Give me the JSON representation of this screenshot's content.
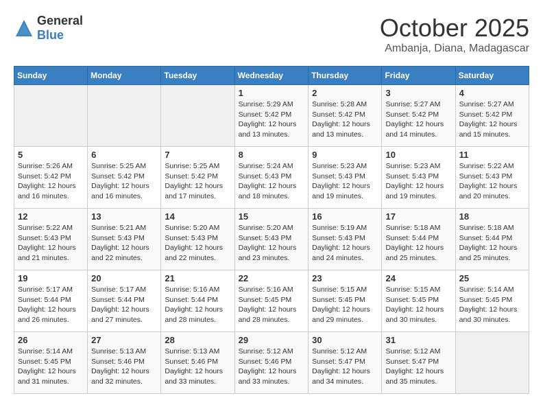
{
  "header": {
    "logo": {
      "general": "General",
      "blue": "Blue"
    },
    "title": "October 2025",
    "location": "Ambanja, Diana, Madagascar"
  },
  "calendar": {
    "days_of_week": [
      "Sunday",
      "Monday",
      "Tuesday",
      "Wednesday",
      "Thursday",
      "Friday",
      "Saturday"
    ],
    "weeks": [
      [
        {
          "day": "",
          "info": ""
        },
        {
          "day": "",
          "info": ""
        },
        {
          "day": "",
          "info": ""
        },
        {
          "day": "1",
          "sunrise": "Sunrise: 5:29 AM",
          "sunset": "Sunset: 5:42 PM",
          "daylight": "Daylight: 12 hours and 13 minutes."
        },
        {
          "day": "2",
          "sunrise": "Sunrise: 5:28 AM",
          "sunset": "Sunset: 5:42 PM",
          "daylight": "Daylight: 12 hours and 13 minutes."
        },
        {
          "day": "3",
          "sunrise": "Sunrise: 5:27 AM",
          "sunset": "Sunset: 5:42 PM",
          "daylight": "Daylight: 12 hours and 14 minutes."
        },
        {
          "day": "4",
          "sunrise": "Sunrise: 5:27 AM",
          "sunset": "Sunset: 5:42 PM",
          "daylight": "Daylight: 12 hours and 15 minutes."
        }
      ],
      [
        {
          "day": "5",
          "sunrise": "Sunrise: 5:26 AM",
          "sunset": "Sunset: 5:42 PM",
          "daylight": "Daylight: 12 hours and 16 minutes."
        },
        {
          "day": "6",
          "sunrise": "Sunrise: 5:25 AM",
          "sunset": "Sunset: 5:42 PM",
          "daylight": "Daylight: 12 hours and 16 minutes."
        },
        {
          "day": "7",
          "sunrise": "Sunrise: 5:25 AM",
          "sunset": "Sunset: 5:42 PM",
          "daylight": "Daylight: 12 hours and 17 minutes."
        },
        {
          "day": "8",
          "sunrise": "Sunrise: 5:24 AM",
          "sunset": "Sunset: 5:43 PM",
          "daylight": "Daylight: 12 hours and 18 minutes."
        },
        {
          "day": "9",
          "sunrise": "Sunrise: 5:23 AM",
          "sunset": "Sunset: 5:43 PM",
          "daylight": "Daylight: 12 hours and 19 minutes."
        },
        {
          "day": "10",
          "sunrise": "Sunrise: 5:23 AM",
          "sunset": "Sunset: 5:43 PM",
          "daylight": "Daylight: 12 hours and 19 minutes."
        },
        {
          "day": "11",
          "sunrise": "Sunrise: 5:22 AM",
          "sunset": "Sunset: 5:43 PM",
          "daylight": "Daylight: 12 hours and 20 minutes."
        }
      ],
      [
        {
          "day": "12",
          "sunrise": "Sunrise: 5:22 AM",
          "sunset": "Sunset: 5:43 PM",
          "daylight": "Daylight: 12 hours and 21 minutes."
        },
        {
          "day": "13",
          "sunrise": "Sunrise: 5:21 AM",
          "sunset": "Sunset: 5:43 PM",
          "daylight": "Daylight: 12 hours and 22 minutes."
        },
        {
          "day": "14",
          "sunrise": "Sunrise: 5:20 AM",
          "sunset": "Sunset: 5:43 PM",
          "daylight": "Daylight: 12 hours and 22 minutes."
        },
        {
          "day": "15",
          "sunrise": "Sunrise: 5:20 AM",
          "sunset": "Sunset: 5:43 PM",
          "daylight": "Daylight: 12 hours and 23 minutes."
        },
        {
          "day": "16",
          "sunrise": "Sunrise: 5:19 AM",
          "sunset": "Sunset: 5:43 PM",
          "daylight": "Daylight: 12 hours and 24 minutes."
        },
        {
          "day": "17",
          "sunrise": "Sunrise: 5:18 AM",
          "sunset": "Sunset: 5:44 PM",
          "daylight": "Daylight: 12 hours and 25 minutes."
        },
        {
          "day": "18",
          "sunrise": "Sunrise: 5:18 AM",
          "sunset": "Sunset: 5:44 PM",
          "daylight": "Daylight: 12 hours and 25 minutes."
        }
      ],
      [
        {
          "day": "19",
          "sunrise": "Sunrise: 5:17 AM",
          "sunset": "Sunset: 5:44 PM",
          "daylight": "Daylight: 12 hours and 26 minutes."
        },
        {
          "day": "20",
          "sunrise": "Sunrise: 5:17 AM",
          "sunset": "Sunset: 5:44 PM",
          "daylight": "Daylight: 12 hours and 27 minutes."
        },
        {
          "day": "21",
          "sunrise": "Sunrise: 5:16 AM",
          "sunset": "Sunset: 5:44 PM",
          "daylight": "Daylight: 12 hours and 28 minutes."
        },
        {
          "day": "22",
          "sunrise": "Sunrise: 5:16 AM",
          "sunset": "Sunset: 5:45 PM",
          "daylight": "Daylight: 12 hours and 28 minutes."
        },
        {
          "day": "23",
          "sunrise": "Sunrise: 5:15 AM",
          "sunset": "Sunset: 5:45 PM",
          "daylight": "Daylight: 12 hours and 29 minutes."
        },
        {
          "day": "24",
          "sunrise": "Sunrise: 5:15 AM",
          "sunset": "Sunset: 5:45 PM",
          "daylight": "Daylight: 12 hours and 30 minutes."
        },
        {
          "day": "25",
          "sunrise": "Sunrise: 5:14 AM",
          "sunset": "Sunset: 5:45 PM",
          "daylight": "Daylight: 12 hours and 30 minutes."
        }
      ],
      [
        {
          "day": "26",
          "sunrise": "Sunrise: 5:14 AM",
          "sunset": "Sunset: 5:45 PM",
          "daylight": "Daylight: 12 hours and 31 minutes."
        },
        {
          "day": "27",
          "sunrise": "Sunrise: 5:13 AM",
          "sunset": "Sunset: 5:46 PM",
          "daylight": "Daylight: 12 hours and 32 minutes."
        },
        {
          "day": "28",
          "sunrise": "Sunrise: 5:13 AM",
          "sunset": "Sunset: 5:46 PM",
          "daylight": "Daylight: 12 hours and 33 minutes."
        },
        {
          "day": "29",
          "sunrise": "Sunrise: 5:12 AM",
          "sunset": "Sunset: 5:46 PM",
          "daylight": "Daylight: 12 hours and 33 minutes."
        },
        {
          "day": "30",
          "sunrise": "Sunrise: 5:12 AM",
          "sunset": "Sunset: 5:47 PM",
          "daylight": "Daylight: 12 hours and 34 minutes."
        },
        {
          "day": "31",
          "sunrise": "Sunrise: 5:12 AM",
          "sunset": "Sunset: 5:47 PM",
          "daylight": "Daylight: 12 hours and 35 minutes."
        },
        {
          "day": "",
          "info": ""
        }
      ]
    ]
  }
}
